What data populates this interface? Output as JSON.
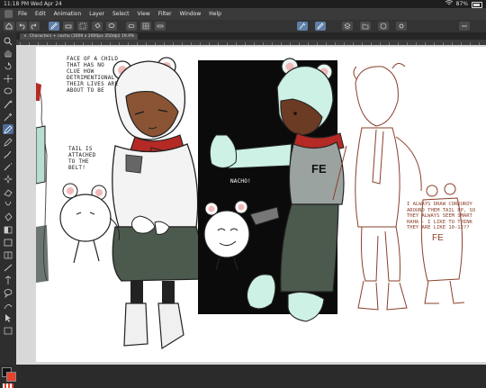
{
  "status_bar": {
    "time": "11:18 PM",
    "date": "Wed Apr 24",
    "battery": "87%"
  },
  "menu": [
    "File",
    "Edit",
    "Animation",
    "Layer",
    "Select",
    "View",
    "Filter",
    "Window",
    "Help"
  ],
  "document_tab": {
    "title": "Characters + nacho (3000 x 2000px 350dpi) 19.9%"
  },
  "canvas": {
    "note_face": "FACE OF A CHILD THAT HAS NO CLUE HOW DETRIMENTIONAL THEIR LIVES ARE ABOUT TO BE",
    "note_tail": "TAIL IS ATTACHED TO THE BELT!",
    "note_nacho": "NACHO!",
    "note_corduroy": "I ALWAYS DRAW CORDUROY AROUND THEM TAIL PP, SO THEY ALWAYS SEEM SMART HAHA - I LIKE TO THINK THEY ARE LIKE 10-12??",
    "shirt_letters": "FE"
  },
  "colors": {
    "main": "#111111",
    "sub": "#e9412c",
    "accent": "#5f7fa8"
  }
}
